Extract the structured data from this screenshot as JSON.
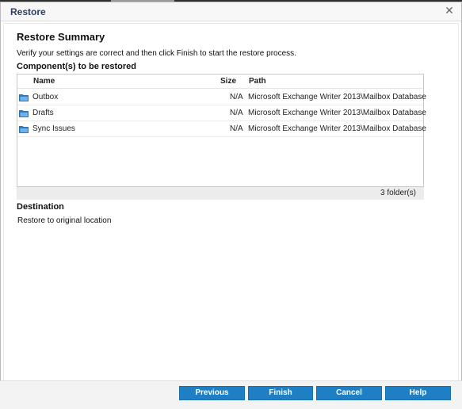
{
  "window": {
    "title": "Restore",
    "close_glyph": "✕"
  },
  "summary": {
    "heading": "Restore Summary",
    "instructions": "Verify your settings are correct and then click Finish to start the restore process."
  },
  "components": {
    "label": "Component(s) to be restored",
    "columns": [
      "Name",
      "Size",
      "Path"
    ],
    "rows": [
      {
        "icon": "folder-icon",
        "name": "Outbox",
        "size": "N/A",
        "path": "Microsoft Exchange Writer 2013\\Mailbox Database"
      },
      {
        "icon": "folder-icon",
        "name": "Drafts",
        "size": "N/A",
        "path": "Microsoft Exchange Writer 2013\\Mailbox Database"
      },
      {
        "icon": "folder-icon",
        "name": "Sync Issues",
        "size": "N/A",
        "path": "Microsoft Exchange Writer 2013\\Mailbox Database"
      }
    ],
    "count": "3 folder(s)"
  },
  "destination": {
    "label": "Destination",
    "value": "Restore to original location"
  },
  "buttons": {
    "previous": "Previous",
    "finish": "Finish",
    "cancel": "Cancel",
    "help": "Help"
  },
  "colors": {
    "button": "#1f7fc4",
    "folder": "#2b7cc9",
    "title_text": "#2c3e63"
  }
}
